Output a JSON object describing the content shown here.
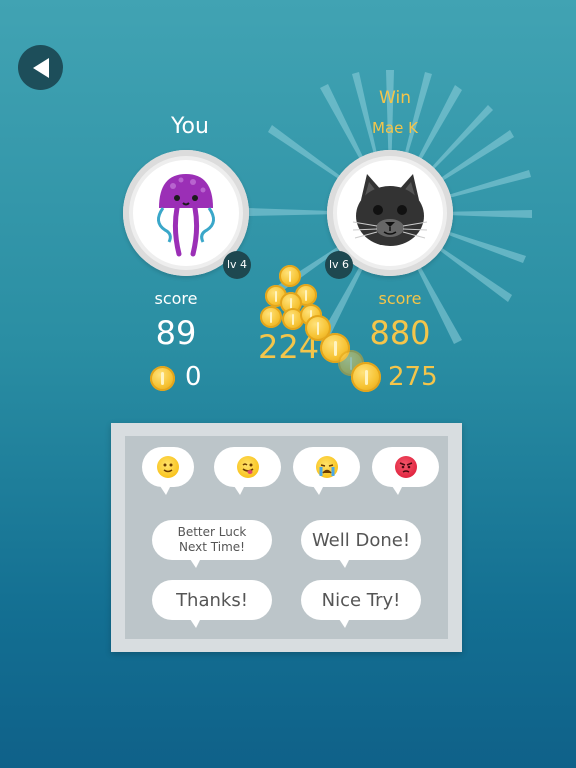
{
  "you": {
    "label": "You",
    "level": "lv 4",
    "score_label": "score",
    "score": "89",
    "coins": "0"
  },
  "opponent": {
    "result": "Win",
    "name": "Mae K",
    "level": "lv 6",
    "score_label": "score",
    "score": "880",
    "coins": "275"
  },
  "transfer_amount": "224",
  "quick_messages": {
    "emojis": [
      "smile-emoji-icon",
      "wink-tongue-emoji-icon",
      "crying-emoji-icon",
      "angry-emoji-icon"
    ],
    "phrases": [
      "Better Luck Next Time!",
      "Well Done!",
      "Thanks!",
      "Nice Try!"
    ]
  },
  "colors": {
    "gold": "#f4c54a",
    "dark": "#1e4850",
    "white": "#ffffff"
  }
}
